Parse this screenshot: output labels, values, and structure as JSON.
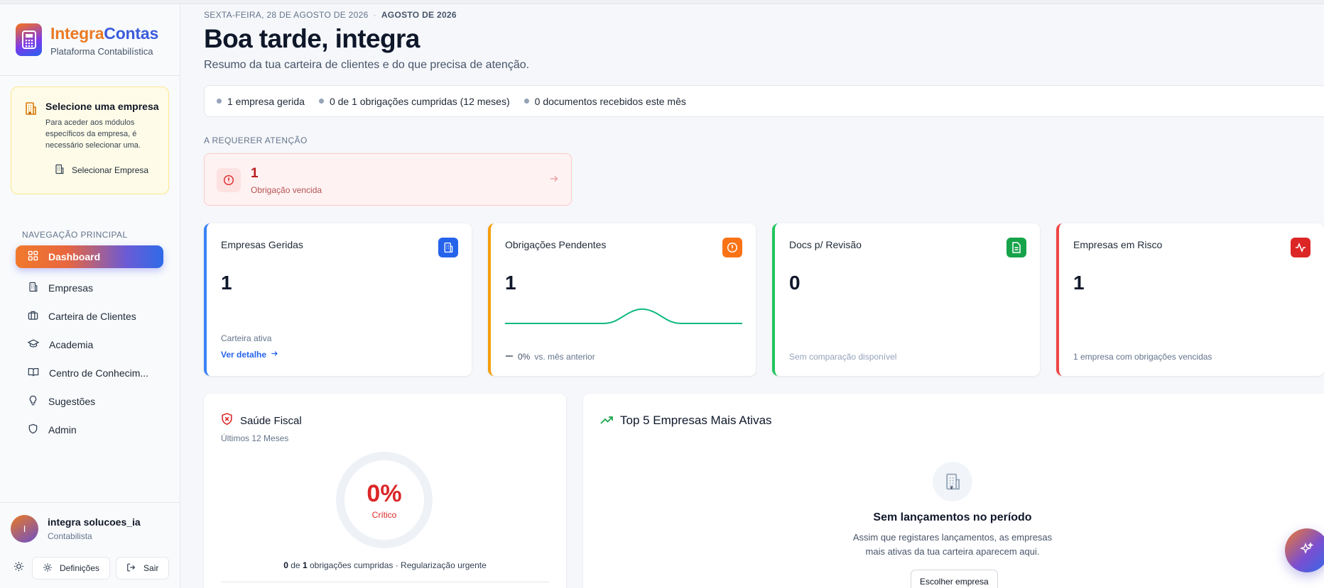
{
  "sidebar": {
    "brand": {
      "part1": "Integra",
      "part2": "Contas",
      "subtitle": "Plataforma Contabilística"
    },
    "select_company": {
      "title": "Selecione uma empresa",
      "text": "Para aceder aos módulos específicos da empresa, é necessário selecionar uma.",
      "button": "Selecionar Empresa"
    },
    "nav_title": "NAVEGAÇÃO PRINCIPAL",
    "items": [
      {
        "label": "Dashboard",
        "icon": "grid-icon",
        "active": true
      },
      {
        "label": "Empresas",
        "icon": "building-icon"
      },
      {
        "label": "Carteira de Clientes",
        "icon": "briefcase-icon"
      },
      {
        "label": "Academia",
        "icon": "graduation-cap-icon"
      },
      {
        "label": "Centro de Conhecim...",
        "icon": "book-icon"
      },
      {
        "label": "Sugestões",
        "icon": "lightbulb-icon"
      },
      {
        "label": "Admin",
        "icon": "shield-icon"
      }
    ],
    "user": {
      "initial": "I",
      "name": "integra solucoes_ia",
      "role": "Contabilista"
    },
    "footer": {
      "settings": "Definições",
      "logout": "Sair"
    }
  },
  "header": {
    "date": "SEXTA-FEIRA, 28 DE AGOSTO DE 2026",
    "separator": "·",
    "period": "AGOSTO DE 2026",
    "greeting": "Boa tarde, integra",
    "subtitle": "Resumo da tua carteira de clientes e do que precisa de atenção."
  },
  "summary": [
    "1 empresa gerida",
    "0 de 1 obrigações cumpridas (12 meses)",
    "0 documentos recebidos este mês"
  ],
  "attention": {
    "title": "A REQUERER ATENÇÃO",
    "card": {
      "value": "1",
      "label": "Obrigação vencida"
    }
  },
  "stats": [
    {
      "title": "Empresas Geridas",
      "value": "1",
      "footnote": "Carteira ativa",
      "link": "Ver detalhe",
      "accent": "#3b82f6",
      "icon": "building-icon"
    },
    {
      "title": "Obrigações Pendentes",
      "value": "1",
      "trend_value": "0%",
      "trend_text": "vs. mês anterior",
      "accent": "#f59e0b",
      "icon": "alert-icon"
    },
    {
      "title": "Docs p/ Revisão",
      "value": "0",
      "footnote": "Sem comparação disponível",
      "accent": "#22c55e",
      "icon": "document-icon"
    },
    {
      "title": "Empresas em Risco",
      "value": "1",
      "footnote": "1 empresa com obrigações vencidas",
      "accent": "#ef4444",
      "icon": "activity-icon"
    }
  ],
  "health": {
    "title": "Saúde Fiscal",
    "subtitle": "Últimos 12 Meses",
    "percent": "0%",
    "status": "Crítico",
    "footer_bold_a": "0",
    "footer_of": "de",
    "footer_bold_b": "1",
    "footer_text": "obrigações cumpridas · Regularização urgente"
  },
  "top5": {
    "title": "Top 5 Empresas Mais Ativas",
    "empty_title": "Sem lançamentos no período",
    "empty_text": "Assim que registares lançamentos, as empresas mais ativas da tua carteira aparecem aqui.",
    "button": "Escolher empresa"
  },
  "colors": {
    "primary": "#2563eb",
    "orange": "#f97316",
    "danger": "#dc2626",
    "success": "#22c55e"
  }
}
